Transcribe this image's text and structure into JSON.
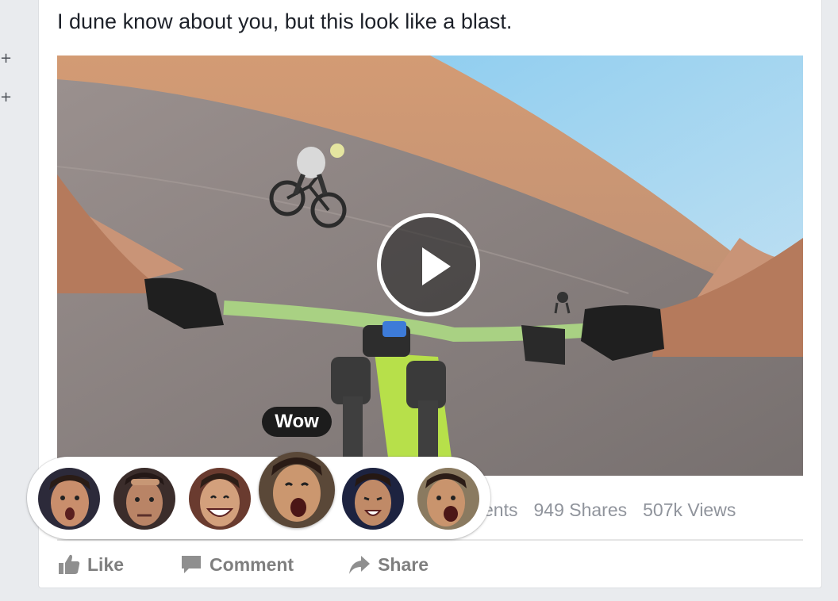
{
  "left_rail": {
    "icons": [
      "plus-icon",
      "plus-icon"
    ]
  },
  "post": {
    "text": "I dune know about you, but this look like a blast.",
    "video": {
      "play_icon": "play-icon"
    }
  },
  "stats": {
    "comments_partial": "ents",
    "shares": "949 Shares",
    "views": "507k Views"
  },
  "actions": {
    "like": {
      "label": "Like",
      "icon": "thumbs-up-icon"
    },
    "comment": {
      "label": "Comment",
      "icon": "speech-bubble-icon"
    },
    "share": {
      "label": "Share",
      "icon": "share-arrow-icon"
    }
  },
  "reactions": {
    "tooltip": "Wow",
    "faces": [
      "surprised-face",
      "serious-face",
      "laughing-face",
      "wow-face",
      "shouting-face",
      "yelling-face"
    ],
    "hovered_index": 3
  },
  "colors": {
    "text": "#1d2129",
    "secondary": "#90949c",
    "action_gray": "#7f7f7f",
    "page_bg": "#e9ebee",
    "tooltip_bg": "#1c1c1c"
  }
}
